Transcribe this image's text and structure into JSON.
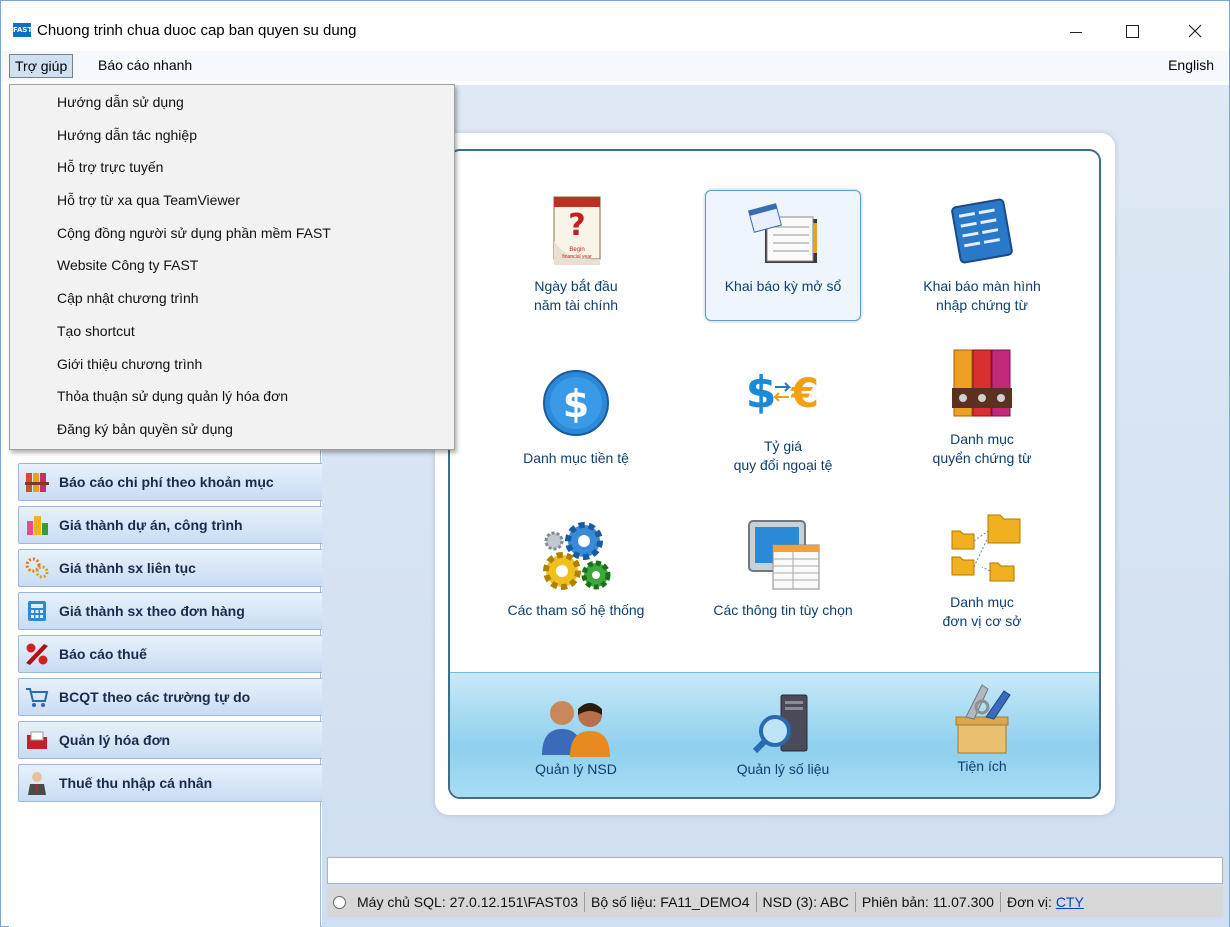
{
  "window": {
    "app_icon_text": "FAST",
    "title": "Chuong trinh chua duoc cap ban quyen su dung"
  },
  "menubar": {
    "help": "Trợ giúp",
    "quick_report": "Báo cáo nhanh",
    "english": "English"
  },
  "help_menu": {
    "items": [
      "Hướng dẫn sử dụng",
      "Hướng dẫn tác nghiệp",
      "Hỗ trợ trực tuyến",
      "Hỗ trợ từ xa qua TeamViewer",
      "Cộng đồng người sử dụng phần mềm FAST",
      "Website Công ty FAST",
      "Cập nhật chương trình",
      "Tạo shortcut",
      "Giới thiệu chương trình",
      "Thỏa thuận sử dụng quản lý hóa đơn",
      "Đăng ký bản quyền sử dụng"
    ]
  },
  "sidebar": {
    "items": [
      {
        "label": "Báo cáo chi phí theo khoản mục",
        "icon": "folders-icon"
      },
      {
        "label": "Giá thành dự án, công trình",
        "icon": "buildings-icon"
      },
      {
        "label": "Giá thành sx liên tục",
        "icon": "gears-icon"
      },
      {
        "label": "Giá thành sx theo đơn hàng",
        "icon": "calculator-icon"
      },
      {
        "label": "Báo cáo thuế",
        "icon": "percent-icon"
      },
      {
        "label": "BCQT theo các trường tự do",
        "icon": "cart-icon"
      },
      {
        "label": "Quản lý hóa đơn",
        "icon": "invoice-folder-icon"
      },
      {
        "label": "Thuế thu nhập cá nhân",
        "icon": "person-icon"
      }
    ]
  },
  "tiles": {
    "fiscal_year_start": {
      "line1": "Ngày bắt đầu",
      "line2": "năm tài chính",
      "icon_text_1": "Begin",
      "icon_text_2": "financial year"
    },
    "opening_period": {
      "line1": "Khai báo kỳ mở sổ"
    },
    "voucher_screen": {
      "line1": "Khai báo màn hình",
      "line2": "nhập chứng từ"
    },
    "currency_list": {
      "line1": "Danh mục tiền tệ"
    },
    "exchange_rate": {
      "line1": "Tỷ giá",
      "line2": "quy đổi ngoại tệ"
    },
    "voucher_books": {
      "line1": "Danh mục",
      "line2": "quyển chứng từ"
    },
    "system_params": {
      "line1": "Các tham số hệ thống"
    },
    "options": {
      "line1": "Các thông tin tùy chọn"
    },
    "base_units": {
      "line1": "Danh mục",
      "line2": "đơn vị cơ sở"
    },
    "user_mgmt": {
      "line1": "Quản lý NSD"
    },
    "data_mgmt": {
      "line1": "Quản lý số liệu"
    },
    "utilities": {
      "line1": "Tiện ích"
    }
  },
  "status": {
    "server": "Máy chủ SQL: 27.0.12.151\\FAST03",
    "database": "Bộ số liệu: FA11_DEMO4",
    "user": "NSD (3): ABC",
    "version": "Phiên bản: 11.07.300",
    "unit_label": "Đơn vị:",
    "unit_value": "CTY"
  }
}
